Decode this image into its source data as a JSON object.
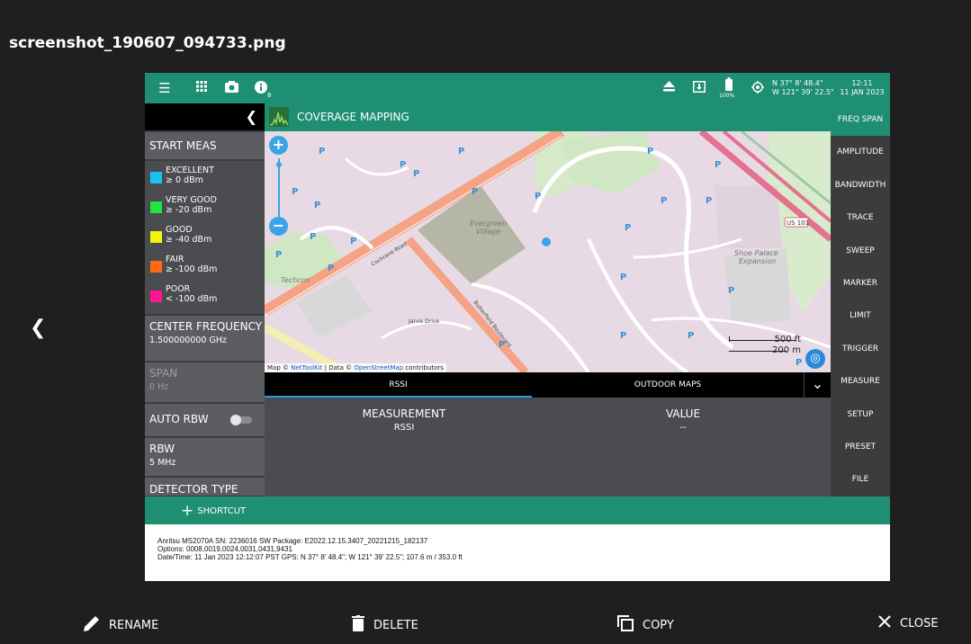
{
  "viewer": {
    "filename": "screenshot_190607_094733.png",
    "actions": {
      "rename": "RENAME",
      "delete": "DELETE",
      "copy": "COPY",
      "close": "CLOSE"
    }
  },
  "device": {
    "topbar": {
      "notification_count": "8",
      "battery": "100%",
      "gps_lat": "N 37° 8' 48.4\"",
      "gps_lon": "W 121° 39' 22.5\"",
      "time": "12:11",
      "date": "11 JAN 2023"
    },
    "left_panel": {
      "start_meas": "START MEAS",
      "legend": [
        {
          "label": "EXCELLENT",
          "range": "≥ 0 dBm",
          "color": "#19c3f0"
        },
        {
          "label": "VERY GOOD",
          "range": "≥ -20 dBm",
          "color": "#1ee63c"
        },
        {
          "label": "GOOD",
          "range": "≥ -40 dBm",
          "color": "#f5f50a"
        },
        {
          "label": "FAIR",
          "range": "≥ -100 dBm",
          "color": "#ff6a14"
        },
        {
          "label": "POOR",
          "range": "< -100 dBm",
          "color": "#ff1493"
        }
      ],
      "center_frequency": {
        "label": "CENTER FREQUENCY",
        "value": "1.500000000 GHz"
      },
      "span": {
        "label": "SPAN",
        "value": "0 Hz"
      },
      "auto_rbw": {
        "label": "AUTO RBW"
      },
      "rbw": {
        "label": "RBW",
        "value": "5 MHz"
      },
      "detector_type": {
        "label": "DETECTOR TYPE"
      }
    },
    "coverage": {
      "title": "COVERAGE MAPPING",
      "map": {
        "attr_prefix": "Map ©",
        "attr_link1": "NetToolKit",
        "attr_mid": "| Data ©",
        "attr_link2": "OpenStreetMap",
        "attr_suffix": "contributors",
        "scale_ft": "500 ft",
        "scale_m": "200 m",
        "labels": {
          "evergreen": "Evergreen Village",
          "shoe_palace": "Shoe Palace Expansion",
          "techcon": "Techcon",
          "us101": "US 101",
          "cochrane": "Cochrane Road",
          "butterfield": "Butterfield Boulevard",
          "jarvis": "Jarvis Drive"
        }
      },
      "tabs": [
        {
          "label": "RSSI"
        },
        {
          "label": "OUTDOOR MAPS"
        }
      ],
      "measurement_header": "MEASUREMENT",
      "value_header": "VALUE",
      "measurement": "RSSI",
      "value": "--"
    },
    "right_menu": [
      "FREQ SPAN",
      "AMPLITUDE",
      "BANDWIDTH",
      "TRACE",
      "SWEEP",
      "MARKER",
      "LIMIT",
      "TRIGGER",
      "MEASURE",
      "SETUP",
      "PRESET",
      "FILE"
    ],
    "shortcut_label": "SHORTCUT",
    "info": {
      "line1": "Anritsu MS2070A SN: 2236016 SW Package: E2022.12.15.3407_20221215_182137",
      "line2": "Options: 0008,0019,0024,0031,0431,9431",
      "line3": "Date/Time: 11 Jan 2023 12:12:07 PST GPS: N 37° 8' 48.4\"; W 121° 39' 22.5\"; 107.6 m / 353.0 ft"
    }
  }
}
